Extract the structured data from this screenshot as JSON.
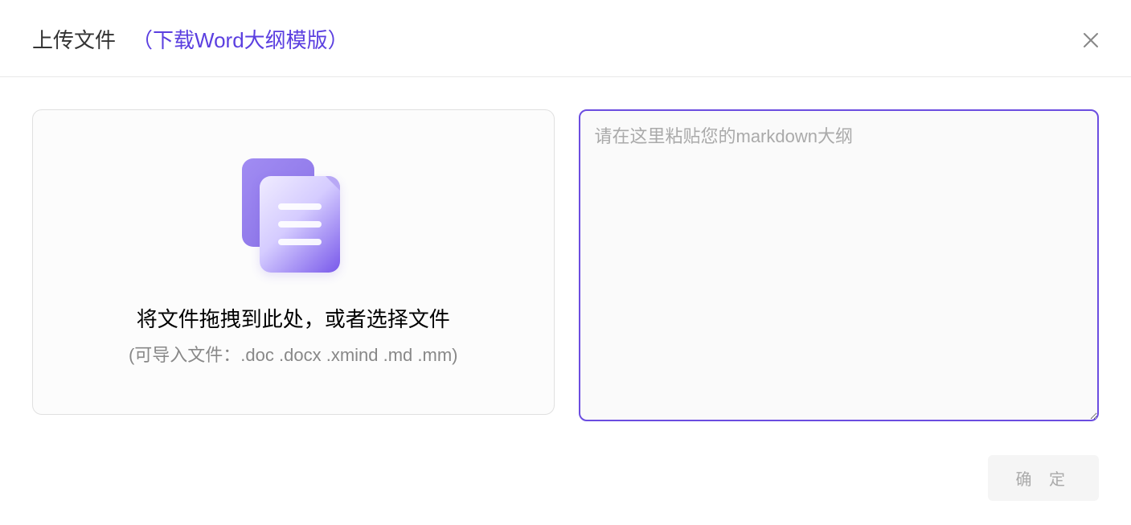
{
  "header": {
    "title": "上传文件",
    "download_link": "（下载Word大纲模版）"
  },
  "upload": {
    "drop_text": "将文件拖拽到此处，或者选择文件",
    "hint_text": "(可导入文件：.doc .docx .xmind .md .mm)"
  },
  "textarea": {
    "placeholder": "请在这里粘贴您的markdown大纲",
    "value": ""
  },
  "footer": {
    "confirm_label": "确 定"
  }
}
